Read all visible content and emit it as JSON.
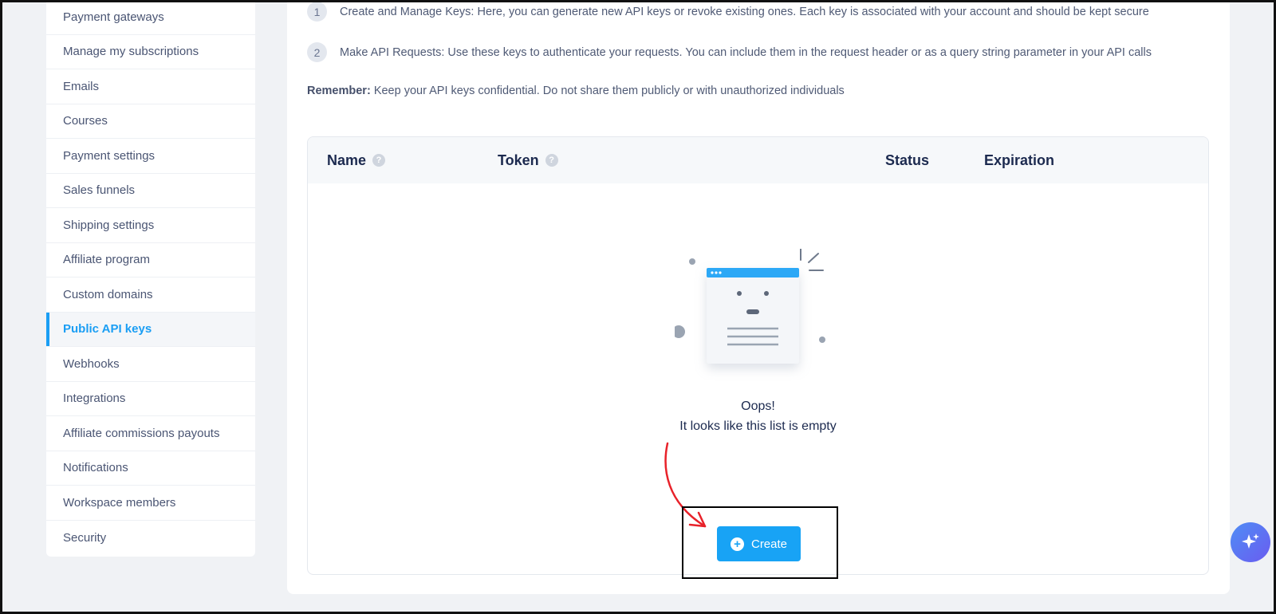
{
  "sidebar": {
    "items": [
      {
        "label": "Payment gateways"
      },
      {
        "label": "Manage my subscriptions"
      },
      {
        "label": "Emails"
      },
      {
        "label": "Courses"
      },
      {
        "label": "Payment settings"
      },
      {
        "label": "Sales funnels"
      },
      {
        "label": "Shipping settings"
      },
      {
        "label": "Affiliate program"
      },
      {
        "label": "Custom domains"
      },
      {
        "label": "Public API keys",
        "active": true
      },
      {
        "label": "Webhooks"
      },
      {
        "label": "Integrations"
      },
      {
        "label": "Affiliate commissions payouts"
      },
      {
        "label": "Notifications"
      },
      {
        "label": "Workspace members"
      },
      {
        "label": "Security"
      }
    ]
  },
  "steps": [
    {
      "num": "1",
      "text": "Create and Manage Keys: Here, you can generate new API keys or revoke existing ones. Each key is associated with your account and should be kept secure"
    },
    {
      "num": "2",
      "text": "Make API Requests: Use these keys to authenticate your requests. You can include them in the request header or as a query string parameter in your API calls"
    }
  ],
  "remember": {
    "label": "Remember:",
    "text": "Keep your API keys confidential. Do not share them publicly or with unauthorized individuals"
  },
  "table": {
    "columns": [
      {
        "label": "Name",
        "help": true
      },
      {
        "label": "Token",
        "help": true
      },
      {
        "label": "Status",
        "help": false
      },
      {
        "label": "Expiration",
        "help": false
      }
    ],
    "help_symbol": "?"
  },
  "empty": {
    "title": "Oops!",
    "subtitle": "It looks like this list is empty"
  },
  "create_button": {
    "label": "Create",
    "icon": "plus-circle-icon"
  },
  "assistant_button": {
    "icon": "sparkle-icon"
  },
  "colors": {
    "accent": "#18a3f5",
    "annotation": "#e8222a",
    "heading": "#1c2a4f"
  }
}
